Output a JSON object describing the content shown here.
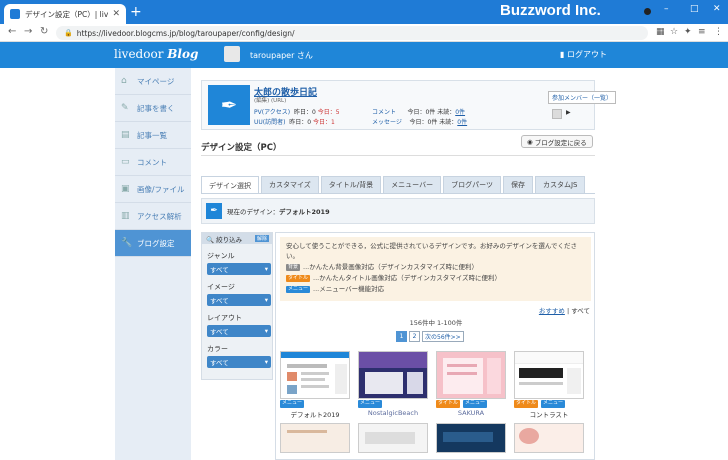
{
  "browser": {
    "tab_title": "デザイン設定（PC）| livedoor Blog",
    "url": "https://livedoor.blogcms.jp/blog/taroupaper/config/design/",
    "brand": "Buzzword Inc."
  },
  "header": {
    "logo_text": "livedoor",
    "logo_blog": "Blog",
    "username": "taroupaper さん",
    "logout": "ログアウト"
  },
  "sidebar": {
    "items": [
      {
        "label": "マイページ"
      },
      {
        "label": "記事を書く"
      },
      {
        "label": "記事一覧"
      },
      {
        "label": "コメント"
      },
      {
        "label": "画像/ファイル"
      },
      {
        "label": "アクセス解析"
      },
      {
        "label": "ブログ設定"
      }
    ]
  },
  "blog": {
    "title": "太郎の散歩日記",
    "links": "(編集) (URL)",
    "pv_label": "PV(アクセス)",
    "pv_yesterday": "昨日：0",
    "pv_today": "今日：5",
    "uu_label": "UU(訪問者)",
    "uu_yesterday": "昨日：0",
    "uu_today": "今日：1",
    "comment_label": "コメント",
    "comment_today": "今日：0件",
    "comment_unread": "未読：",
    "comment_unread_n": "0件",
    "msg_label": "メッセージ",
    "msg_today": "今日：0件",
    "msg_unread": "未読：",
    "msg_unread_n": "0件",
    "member_btn": "参加メンバー（一覧）"
  },
  "section": {
    "title": "デザイン設定（PC）",
    "back_btn": "ブログ設定に戻る"
  },
  "tabs": [
    {
      "label": "デザイン選択"
    },
    {
      "label": "カスタマイズ"
    },
    {
      "label": "タイトル/背景"
    },
    {
      "label": "メニューバー"
    },
    {
      "label": "ブログパーツ"
    },
    {
      "label": "保存"
    },
    {
      "label": "カスタムJS"
    }
  ],
  "current": {
    "label": "現在のデザイン：",
    "name": "デフォルト2019"
  },
  "filter": {
    "head": "絞り込み",
    "badge": "解除",
    "groups": [
      {
        "label": "ジャンル",
        "value": "すべて"
      },
      {
        "label": "イメージ",
        "value": "すべて"
      },
      {
        "label": "レイアウト",
        "value": "すべて"
      },
      {
        "label": "カラー",
        "value": "すべて"
      }
    ]
  },
  "intro": {
    "text": "安心して使うことができる，公式に提供されているデザインです。お好みのデザインを選んでください。",
    "tag_bg": "背景",
    "line_bg": "...かんたん背景画像対応（デザインカスタマイズ時に便利）",
    "tag_title": "タイトル",
    "line_title": "...かんたんタイトル画像対応（デザインカスタマイズ時に便利）",
    "tag_menu": "メニュー",
    "line_menu": "...メニューバー機能対応"
  },
  "sort": {
    "recommend": "おすすめ",
    "sep": " | ",
    "all": "すべて"
  },
  "count": "156件中 1-100件",
  "pager": {
    "p1": "1",
    "p2": "2",
    "next": "次の56件>>"
  },
  "designs": [
    {
      "name": "デフォルト2019",
      "tags": [
        "メニュー"
      ]
    },
    {
      "name": "NostalgicBeach",
      "tags": [
        "メニュー"
      ]
    },
    {
      "name": "SAKURA",
      "tags": [
        "タイトル",
        "メニュー"
      ]
    },
    {
      "name": "コントラスト",
      "tags": [
        "タイトル",
        "メニュー"
      ]
    }
  ]
}
